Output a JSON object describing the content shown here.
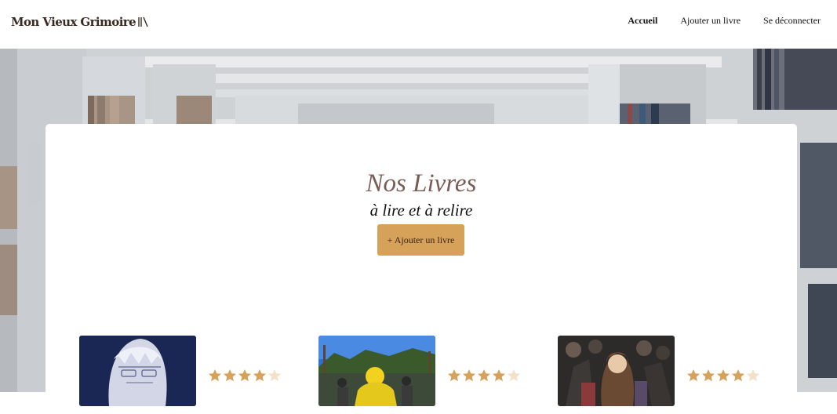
{
  "header": {
    "logo_text": "Mon Vieux Grimoire",
    "nav": [
      {
        "label": "Accueil",
        "active": true
      },
      {
        "label": "Ajouter un livre",
        "active": false
      },
      {
        "label": "Se déconnecter",
        "active": false
      }
    ]
  },
  "main": {
    "title": "Nos Livres",
    "subtitle": "à lire et à relire",
    "add_button_label": "+ Ajouter un livre"
  },
  "books": [
    {
      "rating": 4,
      "max": 5
    },
    {
      "rating": 4,
      "max": 5
    },
    {
      "rating": 4,
      "max": 5
    }
  ],
  "colors": {
    "accent": "#d6a159",
    "title": "#7a5c54",
    "star_filled": "#d6a159",
    "star_empty": "#f1e2c8"
  }
}
